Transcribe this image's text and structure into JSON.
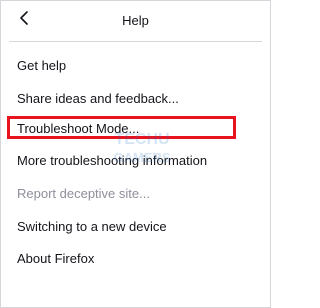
{
  "header": {
    "title": "Help",
    "back_icon": "chevron-left-icon"
  },
  "menu": {
    "items": [
      {
        "label": "Get help",
        "enabled": true
      },
      {
        "label": "Share ideas and feedback...",
        "enabled": true
      },
      {
        "label": "Troubleshoot Mode...",
        "enabled": true,
        "highlighted": true
      },
      {
        "label": "More troubleshooting information",
        "enabled": true
      },
      {
        "label": "Report deceptive site...",
        "enabled": false
      },
      {
        "label": "Switching to a new device",
        "enabled": true
      },
      {
        "label": "About Firefox",
        "enabled": true
      }
    ]
  },
  "annotation": {
    "highlight_color": "#e8131e"
  },
  "watermark": {
    "line1": "TECHU",
    "line2": "GAMERS"
  }
}
